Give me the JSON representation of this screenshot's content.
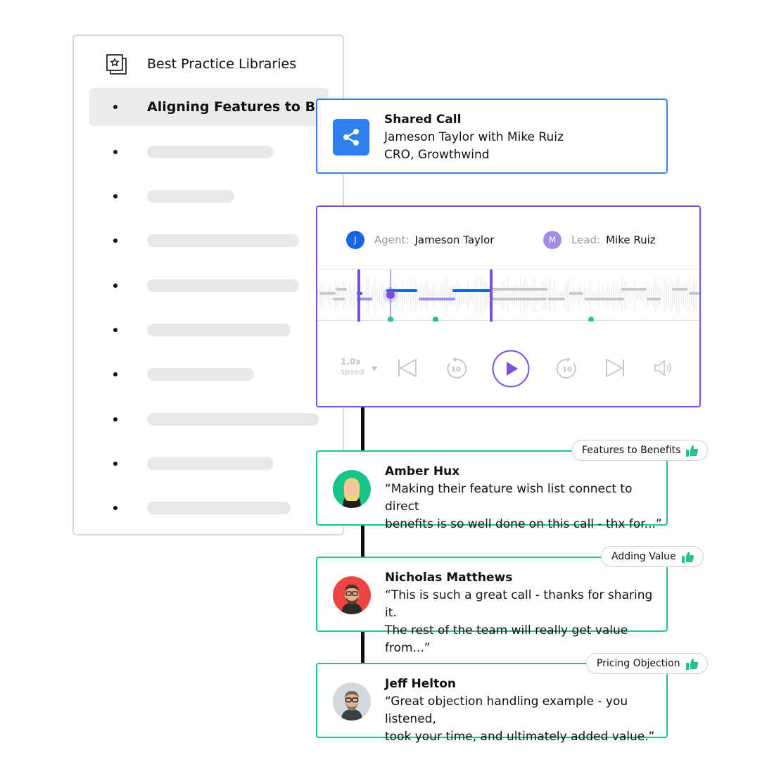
{
  "library": {
    "title": "Best Practice Libraries",
    "icon": "starred-library-icon",
    "active_item": "Aligning Features to Ben...",
    "placeholder_item_count": 9
  },
  "shared_call": {
    "title": "Shared Call",
    "line1": "Jameson Taylor with Mike Ruiz",
    "line2": "CRO, Growthwind",
    "icon": "share-icon",
    "color": "#2f80ed"
  },
  "player": {
    "agent": {
      "role": "Agent:",
      "name": "Jameson Taylor",
      "initial": "J",
      "color": "#1565e8"
    },
    "lead": {
      "role": "Lead:",
      "name": "Mike Ruiz",
      "initial": "M",
      "color": "#a08ee6"
    },
    "speed_value": "1.0x",
    "speed_label": "speed",
    "skip_back_seconds": "10",
    "skip_forward_seconds": "10",
    "accent": "#7c4dde"
  },
  "comments": [
    {
      "name": "Amber Hux",
      "line1": "“Making their feature wish list connect to direct",
      "line2": "benefits is so well done on this call - thx for...”",
      "tag": "Features to Benefits"
    },
    {
      "name": "Nicholas Matthews",
      "line1": "“This is such  a great call - thanks for sharing it.",
      "line2": "The rest of the team will really get value from...”",
      "tag": "Adding Value"
    },
    {
      "name": "Jeff Helton",
      "line1": "“Great objection handling example - you listened,",
      "line2": "took your time, and ultimately added value.”",
      "tag": "Pricing Objection"
    }
  ],
  "colors": {
    "comment_border": "#26c28b",
    "thumbs_up": "#2ec08a",
    "player_border": "#7c4dde",
    "shared_border": "#3b82f0"
  }
}
